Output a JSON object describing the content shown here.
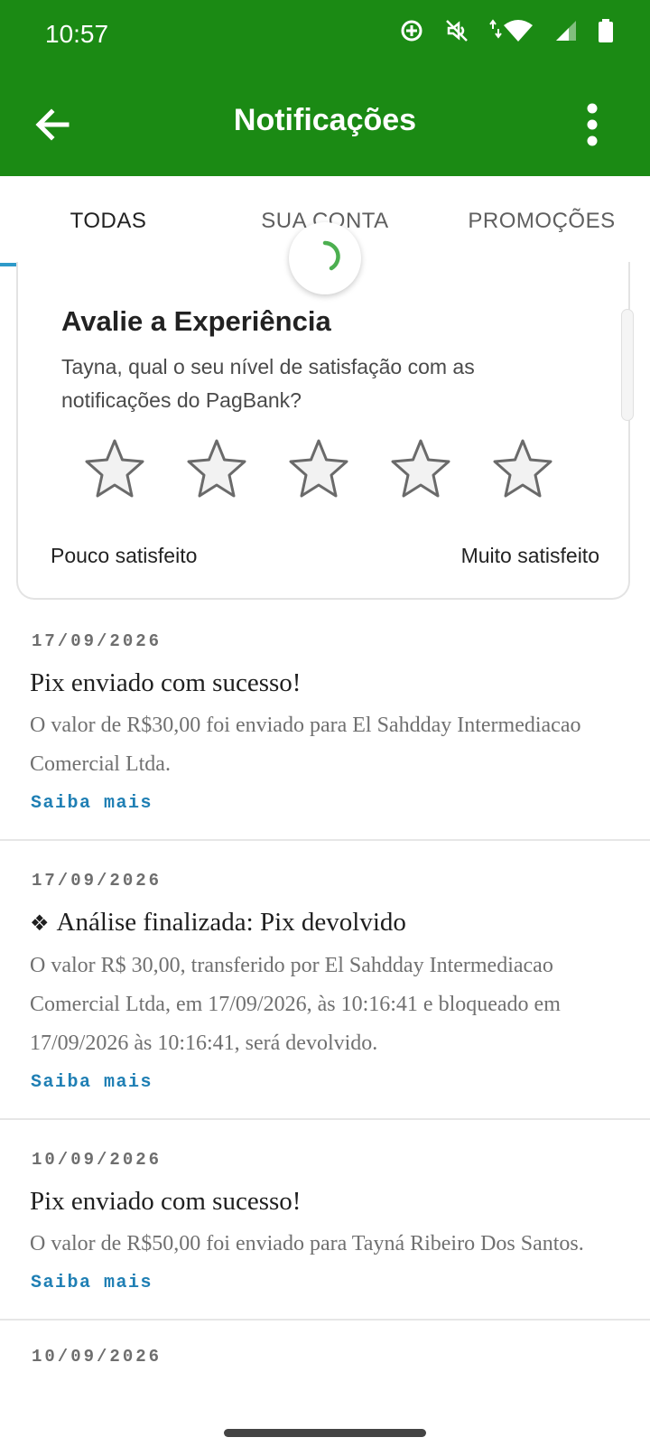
{
  "status_bar": {
    "time": "10:57",
    "icons": [
      "data-saver-icon",
      "mute-icon",
      "wifi-icon",
      "signal-icon",
      "battery-icon"
    ]
  },
  "app_bar": {
    "title": "Notificações",
    "back_icon": "arrow-back-icon",
    "menu_icon": "more-vert-icon"
  },
  "tabs": [
    {
      "label": "TODAS",
      "active": true
    },
    {
      "label": "SUA CONTA",
      "active": false
    },
    {
      "label": "PROMOÇÕES",
      "active": false
    }
  ],
  "rating_card": {
    "title": "Avalie a Experiência",
    "question": "Tayna, qual o seu nível de satisfação com as notificações do PagBank?",
    "stars": 5,
    "low_label": "Pouco satisfeito",
    "high_label": "Muito satisfeito"
  },
  "notifications": [
    {
      "date": "17/09/2026",
      "title": "Pix enviado com sucesso!",
      "body": "O valor de R$30,00 foi enviado para El Sahdday Intermediacao Comercial Ltda.",
      "link": "Saiba mais"
    },
    {
      "date": "17/09/2026",
      "prefix": "❖",
      "title": "Análise finalizada: Pix devolvido",
      "body": "O valor R$ 30,00, transferido por El Sahdday Intermediacao Comercial Ltda, em 17/09/2026, às 10:16:41 e bloqueado em 17/09/2026 às 10:16:41, será devolvido.",
      "link": "Saiba mais"
    },
    {
      "date": "10/09/2026",
      "title": "Pix enviado com sucesso!",
      "body": "O valor de R$50,00 foi enviado para Tayná Ribeiro Dos Santos.",
      "link": "Saiba mais"
    },
    {
      "date": "10/09/2026"
    }
  ],
  "colors": {
    "brand_green": "#1b8a14",
    "tab_indicator": "#2e9ac9",
    "link": "#1f7fb4",
    "spinner": "#4caf50"
  }
}
